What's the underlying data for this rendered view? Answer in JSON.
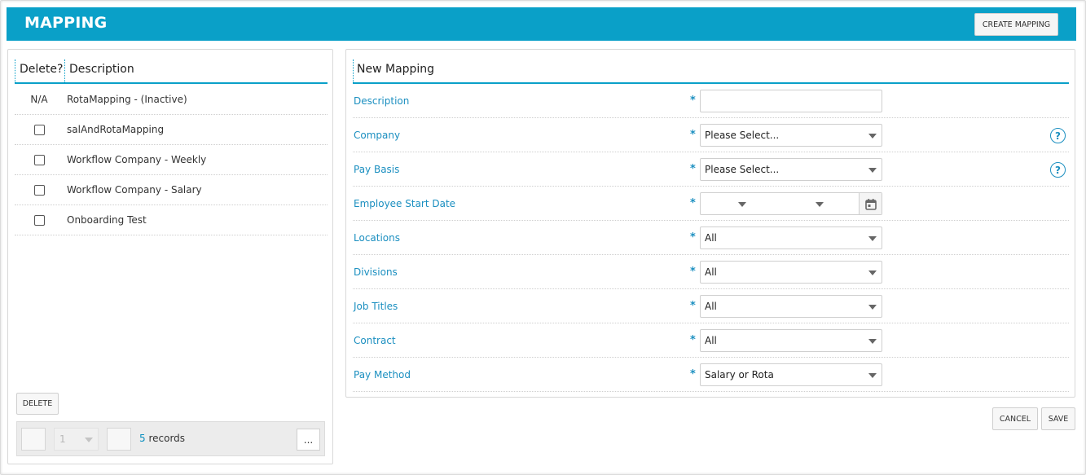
{
  "header": {
    "title": "MAPPING",
    "create_button": "CREATE MAPPING"
  },
  "mappings_list": {
    "columns": {
      "delete": "Delete?",
      "description": "Description"
    },
    "rows": [
      {
        "delete": "N/A",
        "checkbox": false,
        "description": "RotaMapping - (Inactive)"
      },
      {
        "delete": "",
        "checkbox": true,
        "description": "salAndRotaMapping"
      },
      {
        "delete": "",
        "checkbox": true,
        "description": "Workflow Company - Weekly"
      },
      {
        "delete": "",
        "checkbox": true,
        "description": "Workflow Company - Salary"
      },
      {
        "delete": "",
        "checkbox": true,
        "description": "Onboarding Test"
      }
    ],
    "delete_button": "DELETE",
    "pager": {
      "page": "1",
      "record_count": "5",
      "records_label": "records",
      "more": "..."
    }
  },
  "form": {
    "title": "New Mapping",
    "required_marker": "*",
    "fields": {
      "description": {
        "label": "Description",
        "value": ""
      },
      "company": {
        "label": "Company",
        "value": "Please Select..."
      },
      "pay_basis": {
        "label": "Pay Basis",
        "value": "Please Select..."
      },
      "employee_start_date": {
        "label": "Employee Start Date",
        "value": ""
      },
      "locations": {
        "label": "Locations",
        "value": "All"
      },
      "divisions": {
        "label": "Divisions",
        "value": "All"
      },
      "job_titles": {
        "label": "Job Titles",
        "value": "All"
      },
      "contract": {
        "label": "Contract",
        "value": "All"
      },
      "pay_method": {
        "label": "Pay Method",
        "value": "Salary or Rota"
      }
    },
    "help_symbol": "?",
    "cancel_button": "CANCEL",
    "save_button": "SAVE"
  },
  "colors": {
    "accent": "#0aa0c8",
    "label_blue": "#1b8fc0"
  },
  "icons": {
    "help": "help-question-icon",
    "calendar": "calendar-icon",
    "dropdown": "chevron-down-icon"
  }
}
